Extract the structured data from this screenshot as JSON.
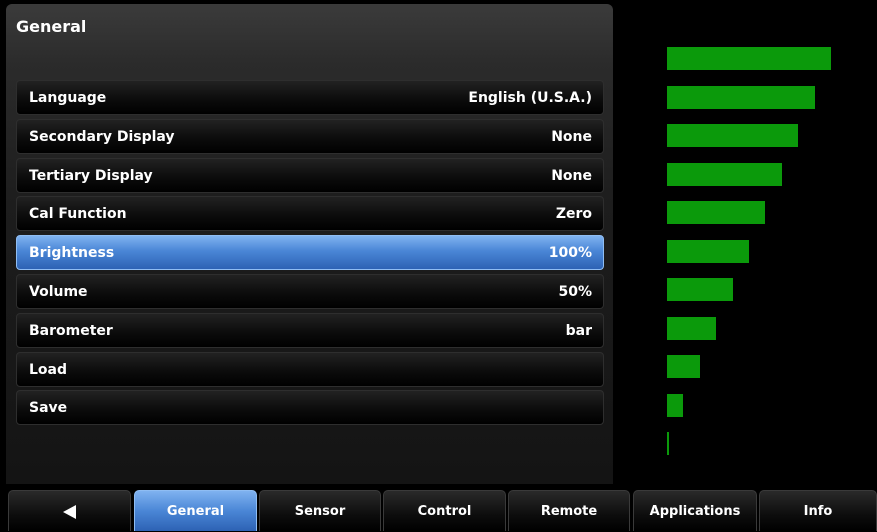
{
  "panel": {
    "title": "General"
  },
  "settings": [
    {
      "label": "Language",
      "value": "English (U.S.A.)"
    },
    {
      "label": "Secondary Display",
      "value": "None"
    },
    {
      "label": "Tertiary Display",
      "value": "None"
    },
    {
      "label": "Cal Function",
      "value": "Zero"
    },
    {
      "label": "Brightness",
      "value": "100%"
    },
    {
      "label": "Volume",
      "value": "50%"
    },
    {
      "label": "Barometer",
      "value": "bar"
    },
    {
      "label": "Load",
      "value": ""
    },
    {
      "label": "Save",
      "value": ""
    }
  ],
  "selected_index": 4,
  "level_bars": {
    "color": "#0b9a0b",
    "levels": [
      1.0,
      0.9,
      0.8,
      0.7,
      0.6,
      0.5,
      0.4,
      0.3,
      0.2,
      0.1,
      0.01
    ]
  },
  "tabs": [
    {
      "label": "",
      "icon": "back-arrow-icon"
    },
    {
      "label": "General"
    },
    {
      "label": "Sensor"
    },
    {
      "label": "Control"
    },
    {
      "label": "Remote"
    },
    {
      "label": "Applications"
    },
    {
      "label": "Info"
    }
  ],
  "active_tab": 1,
  "colors": {
    "selection_blue": "#4a86d6",
    "bar_green": "#0b9a0b"
  }
}
